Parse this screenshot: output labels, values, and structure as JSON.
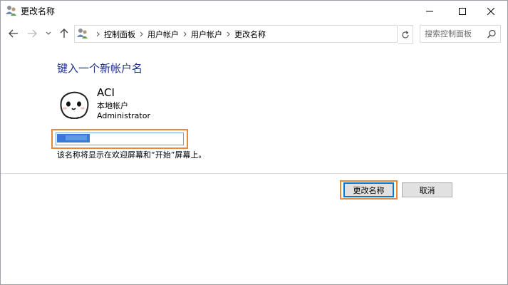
{
  "window": {
    "title": "更改名称",
    "title_icon": "users-control-panel-icon"
  },
  "navigation": {
    "breadcrumbs": [
      "控制面板",
      "用户帐户",
      "用户帐户",
      "更改名称"
    ],
    "search_placeholder": "搜索控制面板"
  },
  "main": {
    "heading": "键入一个新帐户名",
    "account": {
      "name": "ACI",
      "type": "本地帐户",
      "role": "Administrator"
    },
    "new_name_value": "",
    "hint": "该名称将显示在欢迎屏幕和“开始”屏幕上。"
  },
  "buttons": {
    "rename_label": "更改名称",
    "cancel_label": "取消"
  },
  "colors": {
    "heading": "#1e3287",
    "highlight": "#e58a3a",
    "accent": "#0078d7"
  }
}
